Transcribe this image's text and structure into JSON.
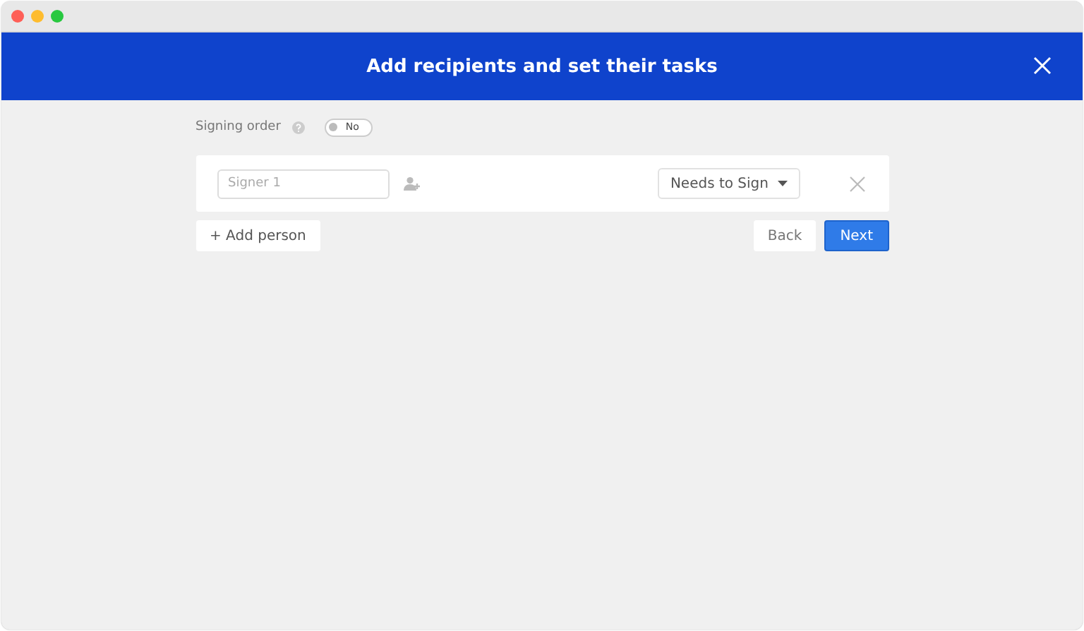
{
  "window": {
    "title": "Add recipients and set their tasks"
  },
  "signing_order": {
    "label": "Signing order",
    "toggle": {
      "on": false,
      "text": "No"
    }
  },
  "signers": [
    {
      "placeholder": "Signer 1",
      "role": "Needs to Sign"
    }
  ],
  "add_person": "+ Add person",
  "buttons": [
    {
      "label": "Back",
      "kind": "secondary"
    },
    {
      "label": "Next",
      "kind": "primary"
    }
  ]
}
